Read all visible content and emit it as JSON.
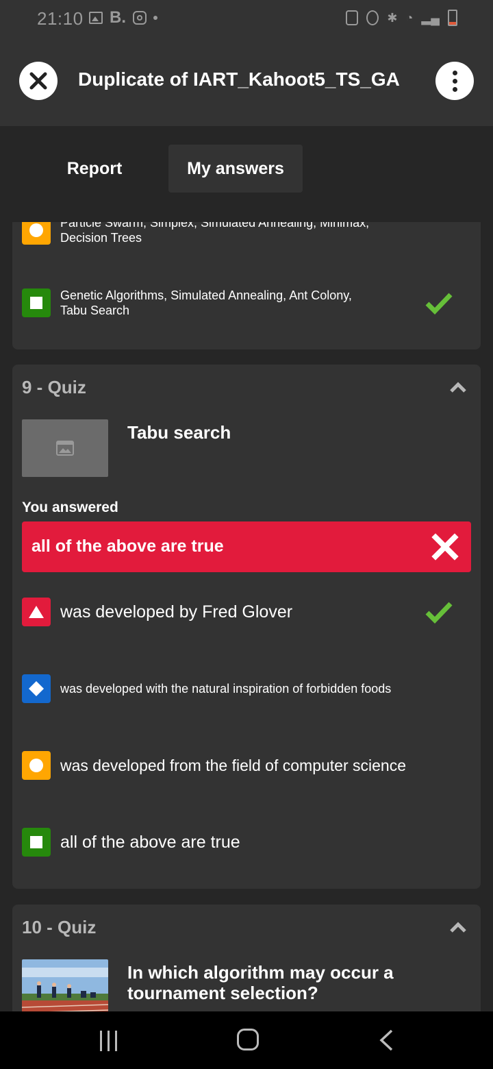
{
  "status_bar": {
    "time": "21:10",
    "b_icon_text": "B."
  },
  "header": {
    "title": "Duplicate of IART_Kahoot5_TS_GA"
  },
  "tabs": [
    {
      "label": "Report"
    },
    {
      "label": "My answers"
    }
  ],
  "previous_question": {
    "answers": [
      {
        "shape": "circle",
        "color": "yellow",
        "text_line1": "Particle Swarm, Simplex, Simulated Annealing, Minimax,",
        "text_line2": "Decision Trees",
        "correct": false
      },
      {
        "shape": "square",
        "color": "green",
        "text_line1": "Genetic Algorithms, Simulated Annealing, Ant Colony,",
        "text_line2": "Tabu Search",
        "correct": true
      }
    ]
  },
  "question_9": {
    "title": "9 - Quiz",
    "question": "Tabu search",
    "you_answered_label": "You answered",
    "user_answer": "all of the above are true",
    "answers": [
      {
        "shape": "triangle",
        "color": "red",
        "text": "was developed by Fred Glover",
        "correct": true
      },
      {
        "shape": "diamond",
        "color": "blue",
        "text": "was developed with the natural inspiration of forbidden foods",
        "correct": false
      },
      {
        "shape": "circle",
        "color": "yellow",
        "text": "was developed from the field of computer science",
        "correct": false
      },
      {
        "shape": "square",
        "color": "green",
        "text": "all of the above are true",
        "correct": false
      }
    ]
  },
  "question_10": {
    "title": "10 - Quiz",
    "question_line1": "In which algorithm may occur a",
    "question_line2": "tournament selection?"
  },
  "colors": {
    "red": "#e21b3c",
    "blue": "#1368ce",
    "yellow": "#ffa602",
    "green": "#26890c",
    "check": "#66bf39"
  }
}
